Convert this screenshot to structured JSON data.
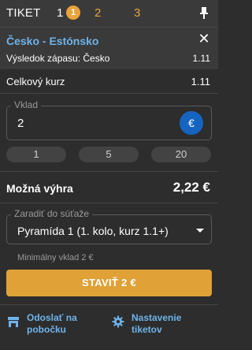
{
  "header": {
    "title": "TIKET",
    "tabs": [
      {
        "label": "1",
        "count": "1"
      },
      {
        "label": "2"
      },
      {
        "label": "3"
      }
    ]
  },
  "match": {
    "name": "Česko - Estónsko",
    "selection": "Výsledok zápasu: Česko",
    "odd": "1.11"
  },
  "total_odds": {
    "label": "Celkový kurz",
    "value": "1.11"
  },
  "stake": {
    "label": "Vklad",
    "value": "2",
    "currency_symbol": "€"
  },
  "quick_stakes": [
    "1",
    "5",
    "20"
  ],
  "possible_win": {
    "label": "Možná výhra",
    "value": "2,22 €"
  },
  "competition": {
    "label": "Zaradiť do súťaže",
    "selected": "Pyramída 1 (1. kolo, kurz 1.1+)",
    "min_stake_note": "Minimálny vklad 2 €"
  },
  "bet_button": {
    "label": "STAVIŤ 2 €"
  },
  "footer": {
    "send_to_branch": "Odoslať na\npobočku",
    "ticket_settings": "Nastavenie\ntiketov"
  },
  "colors": {
    "accent_orange": "#e8a33a",
    "link_blue": "#6fb3ea",
    "euro_button": "#1565c0",
    "background": "#2d2d2d"
  },
  "icons": {
    "pin": "pin-icon",
    "close": "close-icon",
    "branch": "store-icon",
    "settings": "gear-icon"
  }
}
